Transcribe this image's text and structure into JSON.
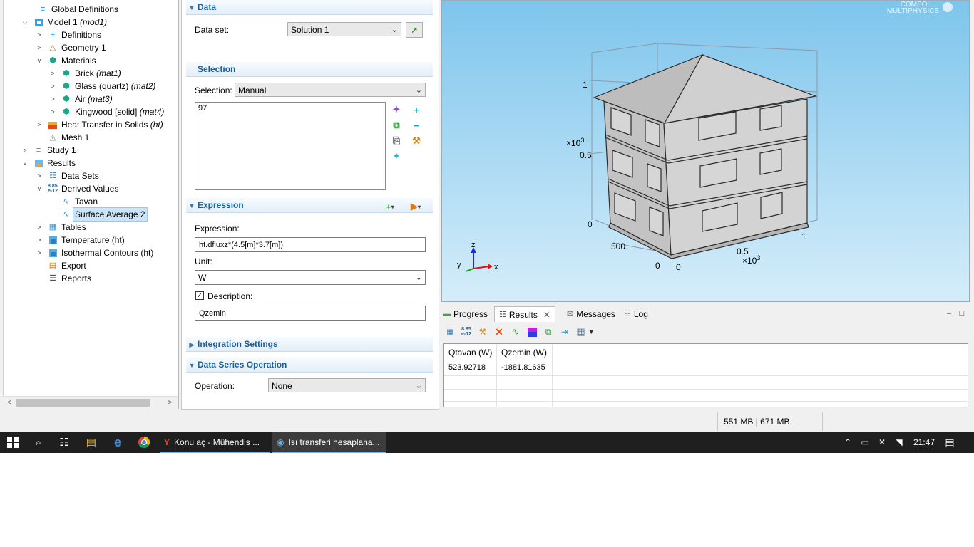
{
  "tree": {
    "items": [
      {
        "label": "Global Definitions",
        "tag": ""
      },
      {
        "label": "Model 1",
        "tag": "(mod1)"
      },
      {
        "label": "Definitions",
        "tag": ""
      },
      {
        "label": "Geometry 1",
        "tag": ""
      },
      {
        "label": "Materials",
        "tag": ""
      },
      {
        "label": "Brick",
        "tag": "(mat1)"
      },
      {
        "label": "Glass (quartz)",
        "tag": "(mat2)"
      },
      {
        "label": "Air",
        "tag": "(mat3)"
      },
      {
        "label": "Kingwood [solid]",
        "tag": "(mat4)"
      },
      {
        "label": "Heat Transfer in Solids",
        "tag": "(ht)"
      },
      {
        "label": "Mesh 1",
        "tag": ""
      },
      {
        "label": "Study 1",
        "tag": ""
      },
      {
        "label": "Results",
        "tag": ""
      },
      {
        "label": "Data Sets",
        "tag": ""
      },
      {
        "label": "Derived Values",
        "tag": ""
      },
      {
        "label": "Tavan",
        "tag": ""
      },
      {
        "label": "Surface Average 2",
        "tag": ""
      },
      {
        "label": "Tables",
        "tag": ""
      },
      {
        "label": "Temperature (ht)",
        "tag": ""
      },
      {
        "label": "Isothermal Contours (ht)",
        "tag": ""
      },
      {
        "label": "Export",
        "tag": ""
      },
      {
        "label": "Reports",
        "tag": ""
      }
    ]
  },
  "settings": {
    "data": {
      "title": "Data",
      "dataset_label": "Data set:",
      "dataset_value": "Solution 1"
    },
    "selection": {
      "title": "Selection",
      "label": "Selection:",
      "value": "Manual",
      "list": [
        "97"
      ]
    },
    "expression": {
      "title": "Expression",
      "expr_label": "Expression:",
      "expr_value": "ht.dfluxz*(4.5[m]*3.7[m])",
      "unit_label": "Unit:",
      "unit_value": "W",
      "desc_label": "Description:",
      "desc_checked": true,
      "desc_value": "Qzemin"
    },
    "integration": {
      "title": "Integration Settings"
    },
    "series": {
      "title": "Data Series Operation",
      "op_label": "Operation:",
      "op_value": "None"
    }
  },
  "graphics": {
    "logo_line1": "COMSOL",
    "logo_line2": "MULTIPHYSICS",
    "axis_z": {
      "ticks": [
        "1",
        "0.5",
        "0"
      ],
      "exp": "×10",
      "sup": "3"
    },
    "axis_x": {
      "ticks": [
        "0",
        "0.5",
        "1"
      ],
      "exp": "×10",
      "sup": "3"
    },
    "axis_y": {
      "ticks": [
        "500",
        "0"
      ]
    },
    "triad": {
      "x": "x",
      "y": "y",
      "z": "z"
    }
  },
  "results_panel": {
    "tabs": [
      "Progress",
      "Results",
      "Messages",
      "Log"
    ],
    "table": {
      "headers": [
        "Qtavan (W)",
        "Qzemin (W)"
      ],
      "rows": [
        [
          "523.92718",
          "-1881.81635"
        ]
      ]
    }
  },
  "status": {
    "memory": "551 MB | 671 MB"
  },
  "taskbar": {
    "apps": [
      "Konu aç - Mühendis ...",
      "Isı transferi hesaplana..."
    ],
    "time": "21:47"
  }
}
